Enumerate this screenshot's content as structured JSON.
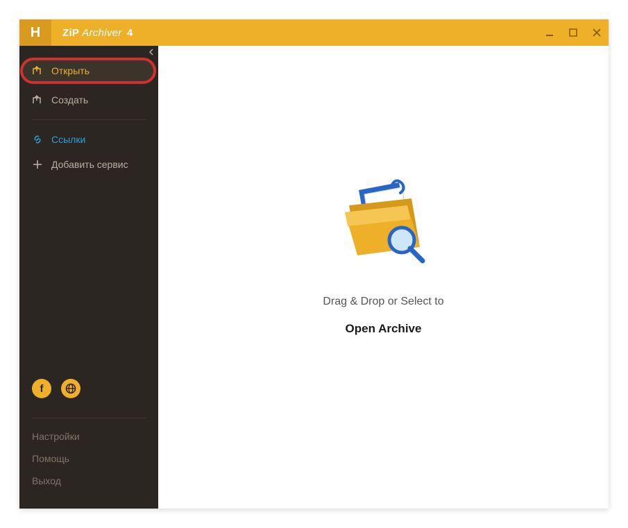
{
  "titlebar": {
    "logo_letter": "H",
    "app_name_zip": "ZiP",
    "app_name_rest": " Archiver",
    "app_version": "4"
  },
  "sidebar": {
    "items": [
      {
        "label": "Открыть"
      },
      {
        "label": "Создать"
      },
      {
        "label": "Ссылки"
      },
      {
        "label": "Добавить сервис"
      }
    ],
    "footer_links": [
      {
        "label": "Настройки"
      },
      {
        "label": "Помощь"
      },
      {
        "label": "Выход"
      }
    ]
  },
  "main": {
    "drop_hint": "Drag & Drop or Select to",
    "open_label": "Open Archive"
  },
  "colors": {
    "accent": "#eeb029",
    "sidebar_bg": "#2b2621",
    "link_blue": "#2ca0d8",
    "highlight_red": "#d03030"
  }
}
